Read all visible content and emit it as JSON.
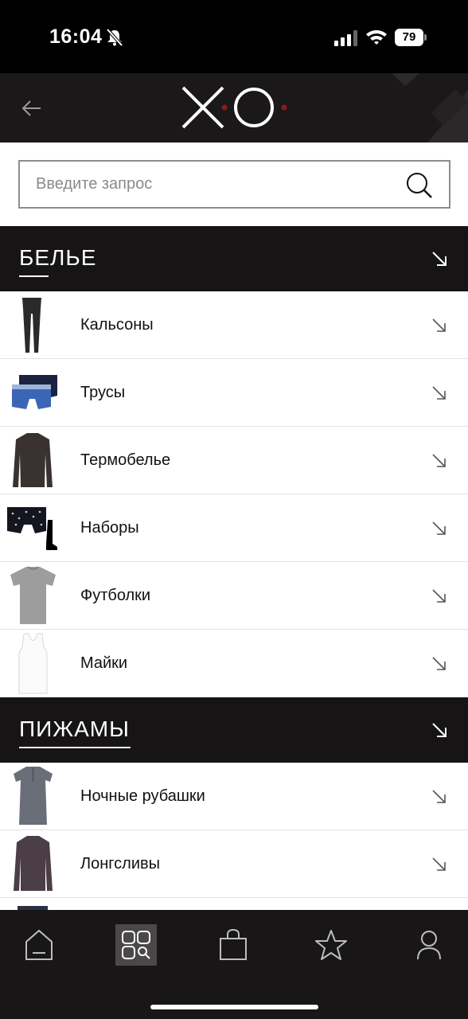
{
  "status_bar": {
    "time": "16:04",
    "battery": "79"
  },
  "header": {
    "logo_text": "XO"
  },
  "search": {
    "placeholder": "Введите запрос",
    "value": ""
  },
  "sections": [
    {
      "title": "БЕЛЬЕ",
      "items": [
        {
          "label": "Кальсоны",
          "thumb": "long-johns"
        },
        {
          "label": "Трусы",
          "thumb": "boxer-briefs"
        },
        {
          "label": "Термобелье",
          "thumb": "thermal-top"
        },
        {
          "label": "Наборы",
          "thumb": "gift-set"
        },
        {
          "label": "Футболки",
          "thumb": "t-shirt"
        },
        {
          "label": "Майки",
          "thumb": "tank-top"
        }
      ]
    },
    {
      "title": "ПИЖАМЫ",
      "items": [
        {
          "label": "Ночные рубашки",
          "thumb": "nightshirt"
        },
        {
          "label": "Лонгсливы",
          "thumb": "longsleeve"
        }
      ]
    }
  ],
  "bottom_nav": [
    {
      "name": "home",
      "icon": "home-icon",
      "active": false
    },
    {
      "name": "catalog",
      "icon": "catalog-search-icon",
      "active": true
    },
    {
      "name": "cart",
      "icon": "shopping-bag-icon",
      "active": false
    },
    {
      "name": "favorites",
      "icon": "star-icon",
      "active": false
    },
    {
      "name": "profile",
      "icon": "user-icon",
      "active": false
    }
  ],
  "colors": {
    "header_bg": "#1a1818",
    "accent_red": "#8b1a1a",
    "text": "#111111"
  }
}
